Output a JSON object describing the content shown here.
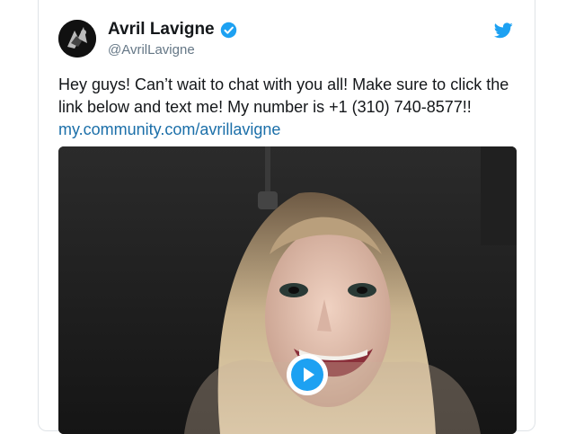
{
  "tweet": {
    "author_name": "Avril Lavigne",
    "handle": "@AvrilLavigne",
    "verified": true,
    "text": "Hey guys! Can’t wait to chat with you all! Make sure to click the link below and text me! My number is +1 (310) 740-8577!!",
    "link": "my.community.com/avrillavigne",
    "media": {
      "type": "video",
      "icon": "play-icon"
    },
    "icons": {
      "verified": "verified-badge-icon",
      "brand": "twitter-bird-icon"
    },
    "colors": {
      "link": "#1b6fa9",
      "verified": "#1da1f2",
      "brand": "#1da1f2"
    }
  }
}
